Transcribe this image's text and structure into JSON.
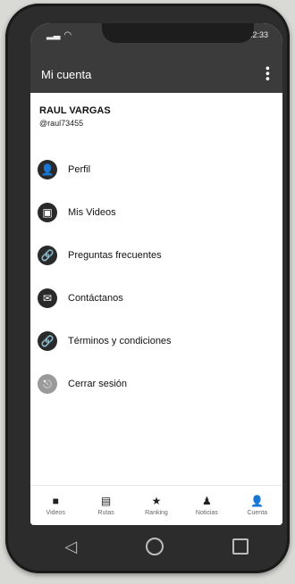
{
  "status": {
    "time": "12:33"
  },
  "header": {
    "title": "Mi cuenta",
    "more_icon": "more-vert-icon"
  },
  "user": {
    "name": "RAUL VARGAS",
    "handle": "@raul73455"
  },
  "menu": [
    {
      "label": "Perfil",
      "icon": "person-icon",
      "glyph": "👤"
    },
    {
      "label": "Mis Videos",
      "icon": "video-icon",
      "glyph": "▣"
    },
    {
      "label": "Preguntas frecuentes",
      "icon": "link-icon",
      "glyph": "🔗"
    },
    {
      "label": "Contáctanos",
      "icon": "mail-icon",
      "glyph": "✉"
    },
    {
      "label": "Términos y condiciones",
      "icon": "link-icon",
      "glyph": "🔗"
    },
    {
      "label": "Cerrar sesión",
      "icon": "logout-icon",
      "glyph": "⎋"
    }
  ],
  "bottom_nav": [
    {
      "label": "Videos",
      "glyph": "■"
    },
    {
      "label": "Rutas",
      "glyph": "▤"
    },
    {
      "label": "Ranking",
      "glyph": "★"
    },
    {
      "label": "Noticias",
      "glyph": "♟"
    },
    {
      "label": "Cuenta",
      "glyph": "👤"
    }
  ],
  "colors": {
    "appbar": "#3b3b3b",
    "screen": "#ffffff"
  }
}
